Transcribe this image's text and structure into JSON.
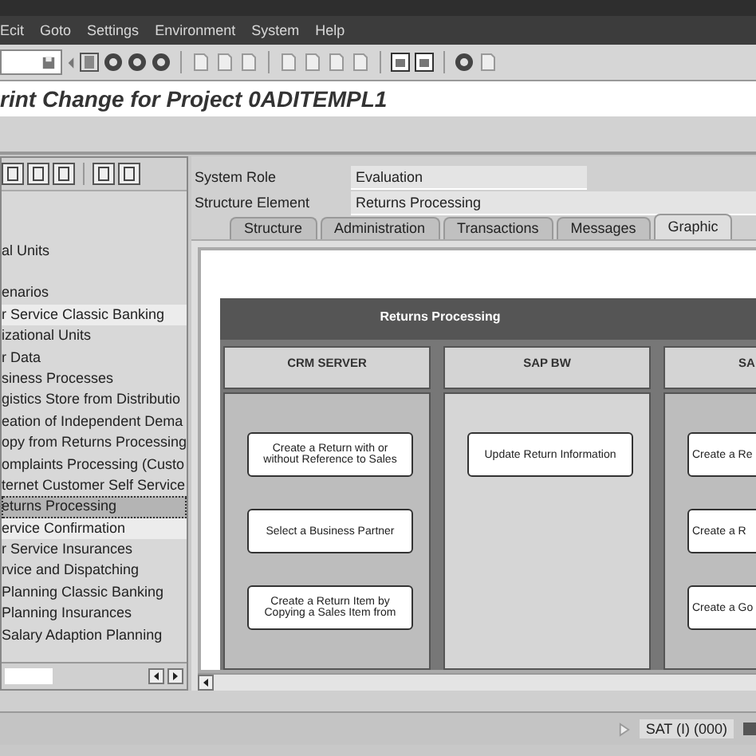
{
  "menu": [
    "Ecit",
    "Goto",
    "Settings",
    "Environment",
    "System",
    "Help"
  ],
  "title": "rint Change for Project 0ADITEMPL1",
  "tree": {
    "items": [
      {
        "label": "al Units",
        "selected": false,
        "highlighted": false
      },
      {
        "label": "enarios",
        "selected": false,
        "highlighted": false
      },
      {
        "label": "r Service Classic Banking",
        "selected": false,
        "highlighted": true
      },
      {
        "label": "izational Units",
        "selected": false,
        "highlighted": false
      },
      {
        "label": "r Data",
        "selected": false,
        "highlighted": false
      },
      {
        "label": "siness Processes",
        "selected": false,
        "highlighted": false
      },
      {
        "label": "gistics Store from Distributio",
        "selected": false,
        "highlighted": false
      },
      {
        "label": "eation of Independent Dema",
        "selected": false,
        "highlighted": false
      },
      {
        "label": "opy from Returns Processing",
        "selected": false,
        "highlighted": false
      },
      {
        "label": "omplaints Processing (Custo",
        "selected": false,
        "highlighted": false
      },
      {
        "label": "ternet Customer Self Service",
        "selected": false,
        "highlighted": false
      },
      {
        "label": "eturns Processing",
        "selected": true,
        "highlighted": false
      },
      {
        "label": "ervice Confirmation",
        "selected": false,
        "highlighted": true
      },
      {
        "label": "r Service Insurances",
        "selected": false,
        "highlighted": false
      },
      {
        "label": "rvice and Dispatching",
        "selected": false,
        "highlighted": false
      },
      {
        "label": "Planning Classic Banking",
        "selected": false,
        "highlighted": false
      },
      {
        "label": "Planning Insurances",
        "selected": false,
        "highlighted": false
      },
      {
        "label": "Salary Adaption Planning",
        "selected": false,
        "highlighted": false
      }
    ]
  },
  "fields": [
    {
      "label": "System Role",
      "value": "Evaluation"
    },
    {
      "label": "Structure Element",
      "value": "Returns Processing"
    }
  ],
  "tabs": [
    {
      "label": "Structure",
      "selected": false
    },
    {
      "label": "Administration",
      "selected": false
    },
    {
      "label": "Transactions",
      "selected": false
    },
    {
      "label": "Messages",
      "selected": false
    },
    {
      "label": "Graphic",
      "selected": true
    }
  ],
  "diagram": {
    "title": "Returns Processing",
    "lanes": [
      {
        "title": "CRM SERVER",
        "steps": [
          "Create a Return with or without Reference to Sales",
          "Select a Business Partner",
          "Create a Return Item by Copying a Sales Item from"
        ]
      },
      {
        "title": "SAP BW",
        "steps": [
          "Update Return Information"
        ]
      },
      {
        "title": "SA",
        "steps": [
          "Create a Re",
          "Create a R",
          "Create a Go"
        ]
      }
    ]
  },
  "status_bar": {
    "system": "SAT (I) (000)"
  }
}
